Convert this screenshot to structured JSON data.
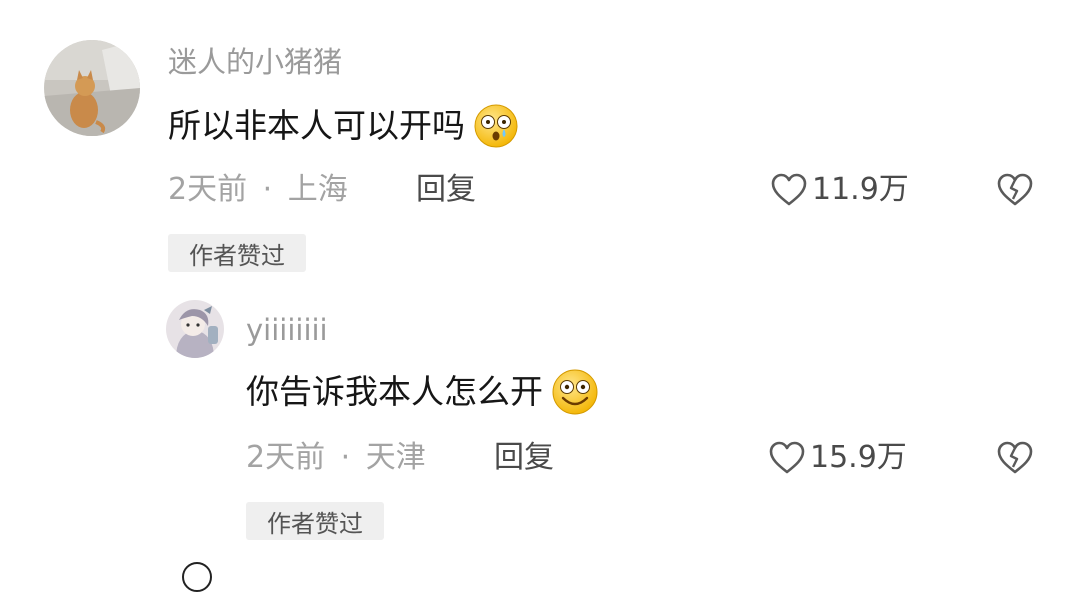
{
  "comments": [
    {
      "username": "迷人的小猪猪",
      "text": "所以非本人可以开吗",
      "text_emoji": "shocked-face-emoji",
      "time": "2天前",
      "separator": "·",
      "location": "上海",
      "reply_label": "回复",
      "likes": "11.9万",
      "badge": "作者赞过",
      "avatar": "cat-photo-avatar"
    },
    {
      "username": "yiiiiiiii",
      "text": "你告诉我本人怎么开",
      "text_emoji": "grinning-face-emoji",
      "time": "2天前",
      "separator": "·",
      "location": "天津",
      "reply_label": "回复",
      "likes": "15.9万",
      "badge": "作者赞过",
      "avatar": "illustrated-avatar"
    }
  ],
  "icons": {
    "like": "heart-outline-icon",
    "dislike": "broken-heart-icon"
  },
  "colors": {
    "username": "#9a9a9a",
    "meta": "#a3a3a3",
    "badge_bg": "#efefef"
  }
}
